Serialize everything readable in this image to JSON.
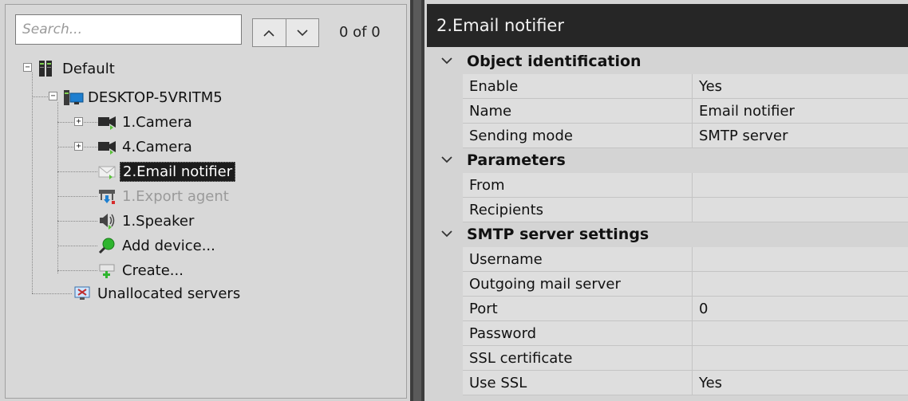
{
  "search": {
    "placeholder": "Search...",
    "match_count": "0 of 0"
  },
  "tree": {
    "root": {
      "label": "Default",
      "icon": "server-group-icon"
    },
    "server": {
      "label": "DESKTOP-5VRITM5",
      "icon": "computer-icon"
    },
    "children": [
      {
        "label": "1.Camera",
        "icon": "camera-icon",
        "state": "normal"
      },
      {
        "label": "4.Camera",
        "icon": "camera-icon",
        "state": "normal"
      },
      {
        "label": "2.Email notifier",
        "icon": "envelope-icon",
        "state": "selected"
      },
      {
        "label": "1.Export agent",
        "icon": "export-agent-icon",
        "state": "disabled"
      },
      {
        "label": "1.Speaker",
        "icon": "speaker-icon",
        "state": "normal"
      },
      {
        "label": "Add device...",
        "icon": "search-icon",
        "state": "normal"
      },
      {
        "label": "Create...",
        "icon": "create-icon",
        "state": "normal"
      }
    ],
    "unallocated": {
      "label": "Unallocated servers",
      "icon": "unallocated-monitor-icon"
    }
  },
  "panel": {
    "title": "2.Email notifier"
  },
  "groups": [
    {
      "title": "Object identification",
      "rows": [
        {
          "name": "Enable",
          "value": "Yes"
        },
        {
          "name": "Name",
          "value": "Email notifier"
        },
        {
          "name": "Sending mode",
          "value": "SMTP server"
        }
      ]
    },
    {
      "title": "Parameters",
      "rows": [
        {
          "name": "From",
          "value": ""
        },
        {
          "name": "Recipients",
          "value": ""
        }
      ]
    },
    {
      "title": "SMTP server settings",
      "rows": [
        {
          "name": "Username",
          "value": ""
        },
        {
          "name": "Outgoing mail server",
          "value": ""
        },
        {
          "name": "Port",
          "value": "0"
        },
        {
          "name": "Password",
          "value": ""
        },
        {
          "name": "SSL certificate",
          "value": ""
        },
        {
          "name": "Use SSL",
          "value": "Yes"
        }
      ]
    }
  ],
  "colors": {
    "header_bg": "#262626",
    "selected_bg": "#1c1c1c",
    "splitter": "#5a5a5a"
  }
}
